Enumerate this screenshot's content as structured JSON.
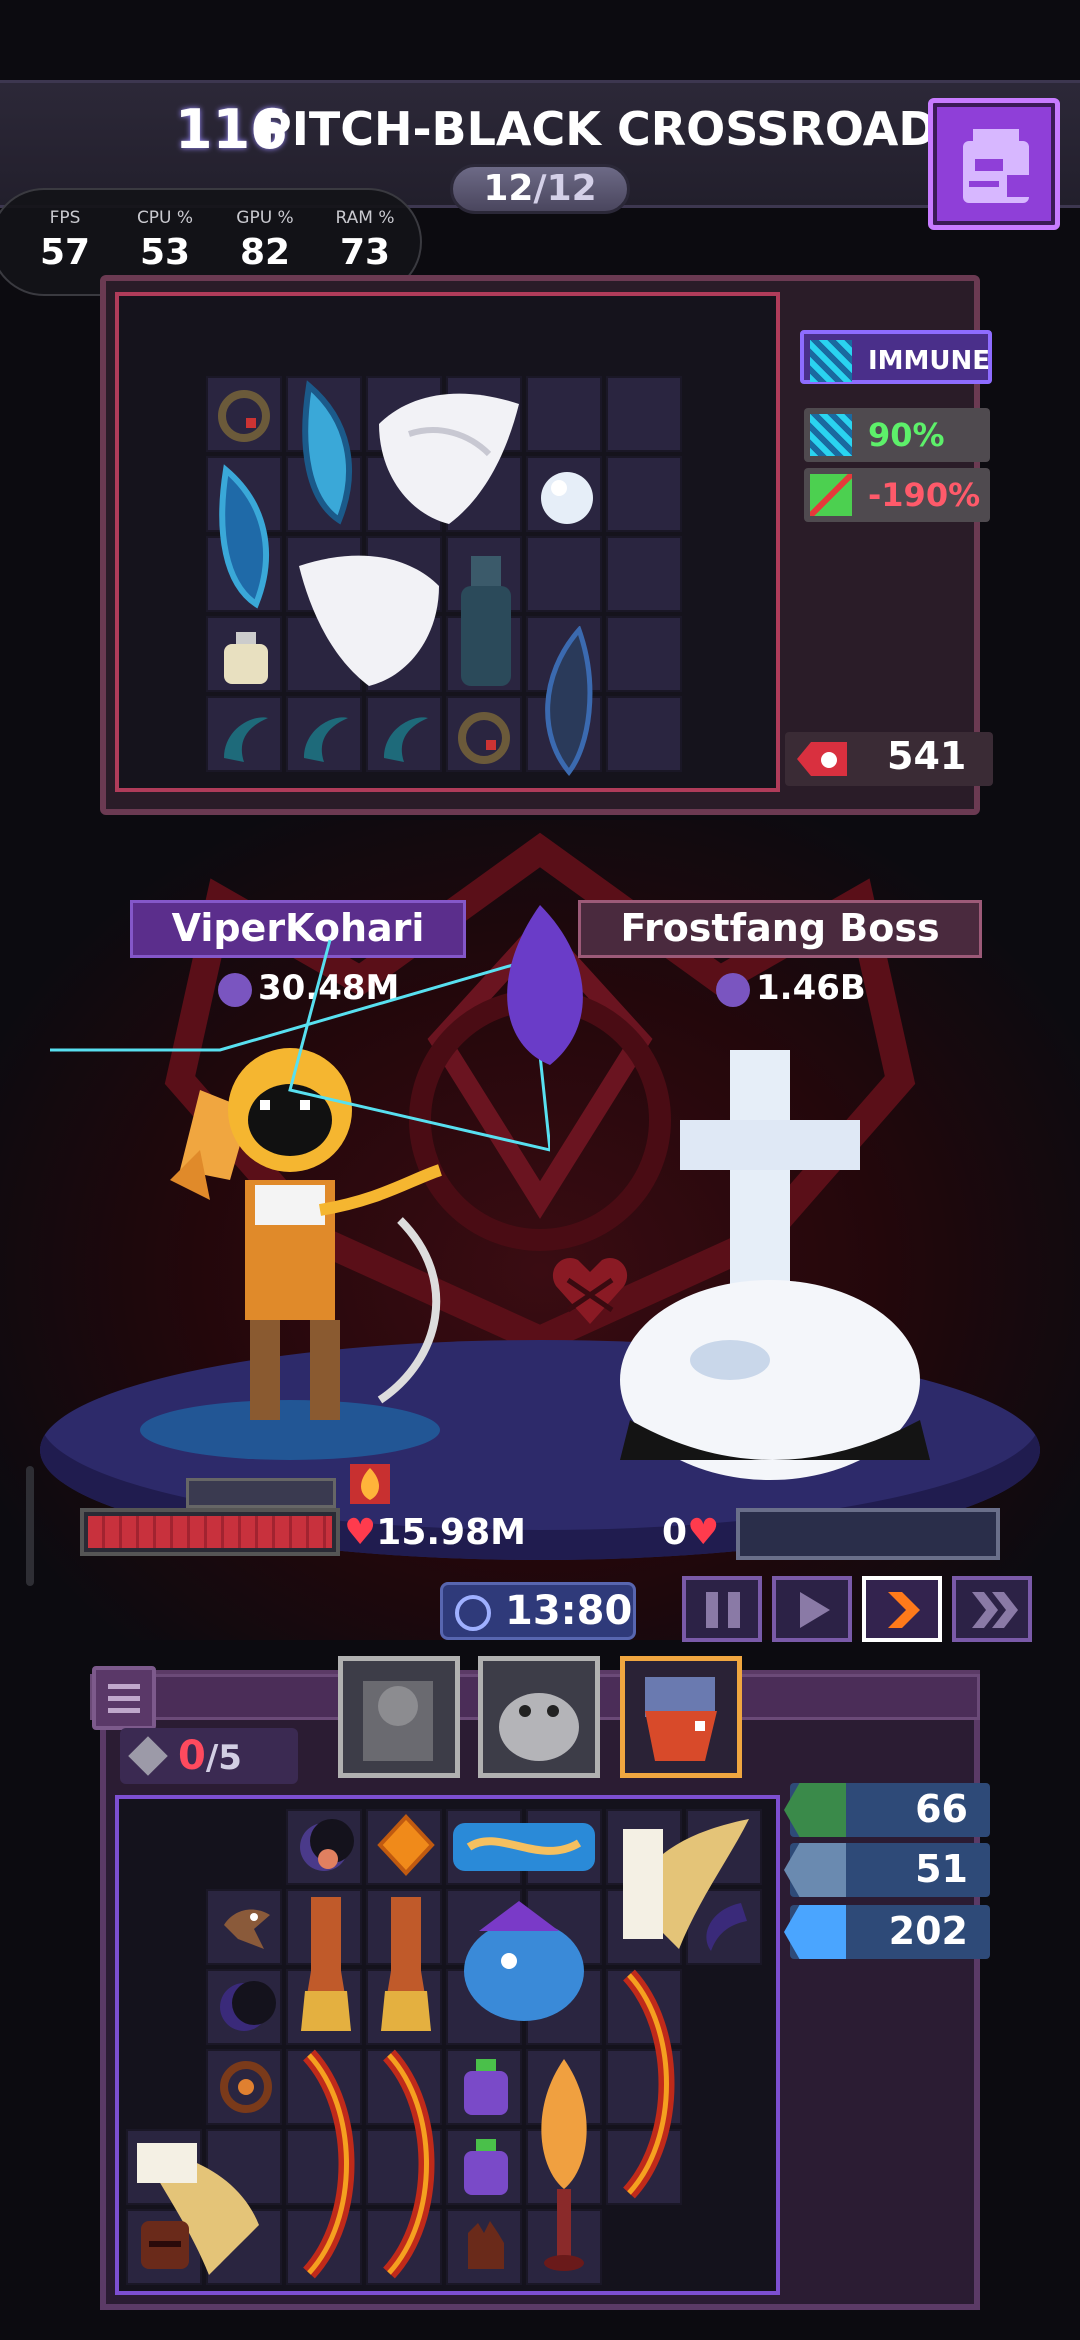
{
  "header": {
    "level": "116",
    "stage_name": "PITCH-BLACK CROSSROADS",
    "wave_current": "12",
    "wave_total": "/12"
  },
  "perf_overlay": [
    {
      "label": "FPS",
      "value": "57"
    },
    {
      "label": "CPU %",
      "value": "53"
    },
    {
      "label": "GPU %",
      "value": "82"
    },
    {
      "label": "RAM %",
      "value": "73"
    }
  ],
  "enemy_panel": {
    "statuses": [
      {
        "icon": "immune-icon",
        "label": "IMMUNE"
      },
      {
        "icon": "hit-chance-icon",
        "label": "90%"
      },
      {
        "icon": "crit-resist-icon",
        "label": "-190%"
      }
    ],
    "power": "541"
  },
  "player": {
    "name": "ViperKohari",
    "power": "30.48M",
    "hp": "15.98M"
  },
  "enemy": {
    "name": "Frostfang Boss",
    "power": "1.46B",
    "hp": "0"
  },
  "timer": "13:80",
  "speed_controls": [
    "pause-icon",
    "play-icon",
    "fast-forward-icon",
    "fastest-forward-icon"
  ],
  "inventory": {
    "slots_used": "0",
    "slots_total": "/5",
    "stats": [
      {
        "icon": "damage-icon",
        "value": "66"
      },
      {
        "icon": "accuracy-icon",
        "value": "51"
      },
      {
        "icon": "speed-icon",
        "value": "202"
      }
    ]
  },
  "colors": {
    "accent_purple": "#8f3fd8",
    "hp_red": "#c8313d",
    "stat_green": "#5df06a",
    "stat_red": "#ff5a6a"
  }
}
